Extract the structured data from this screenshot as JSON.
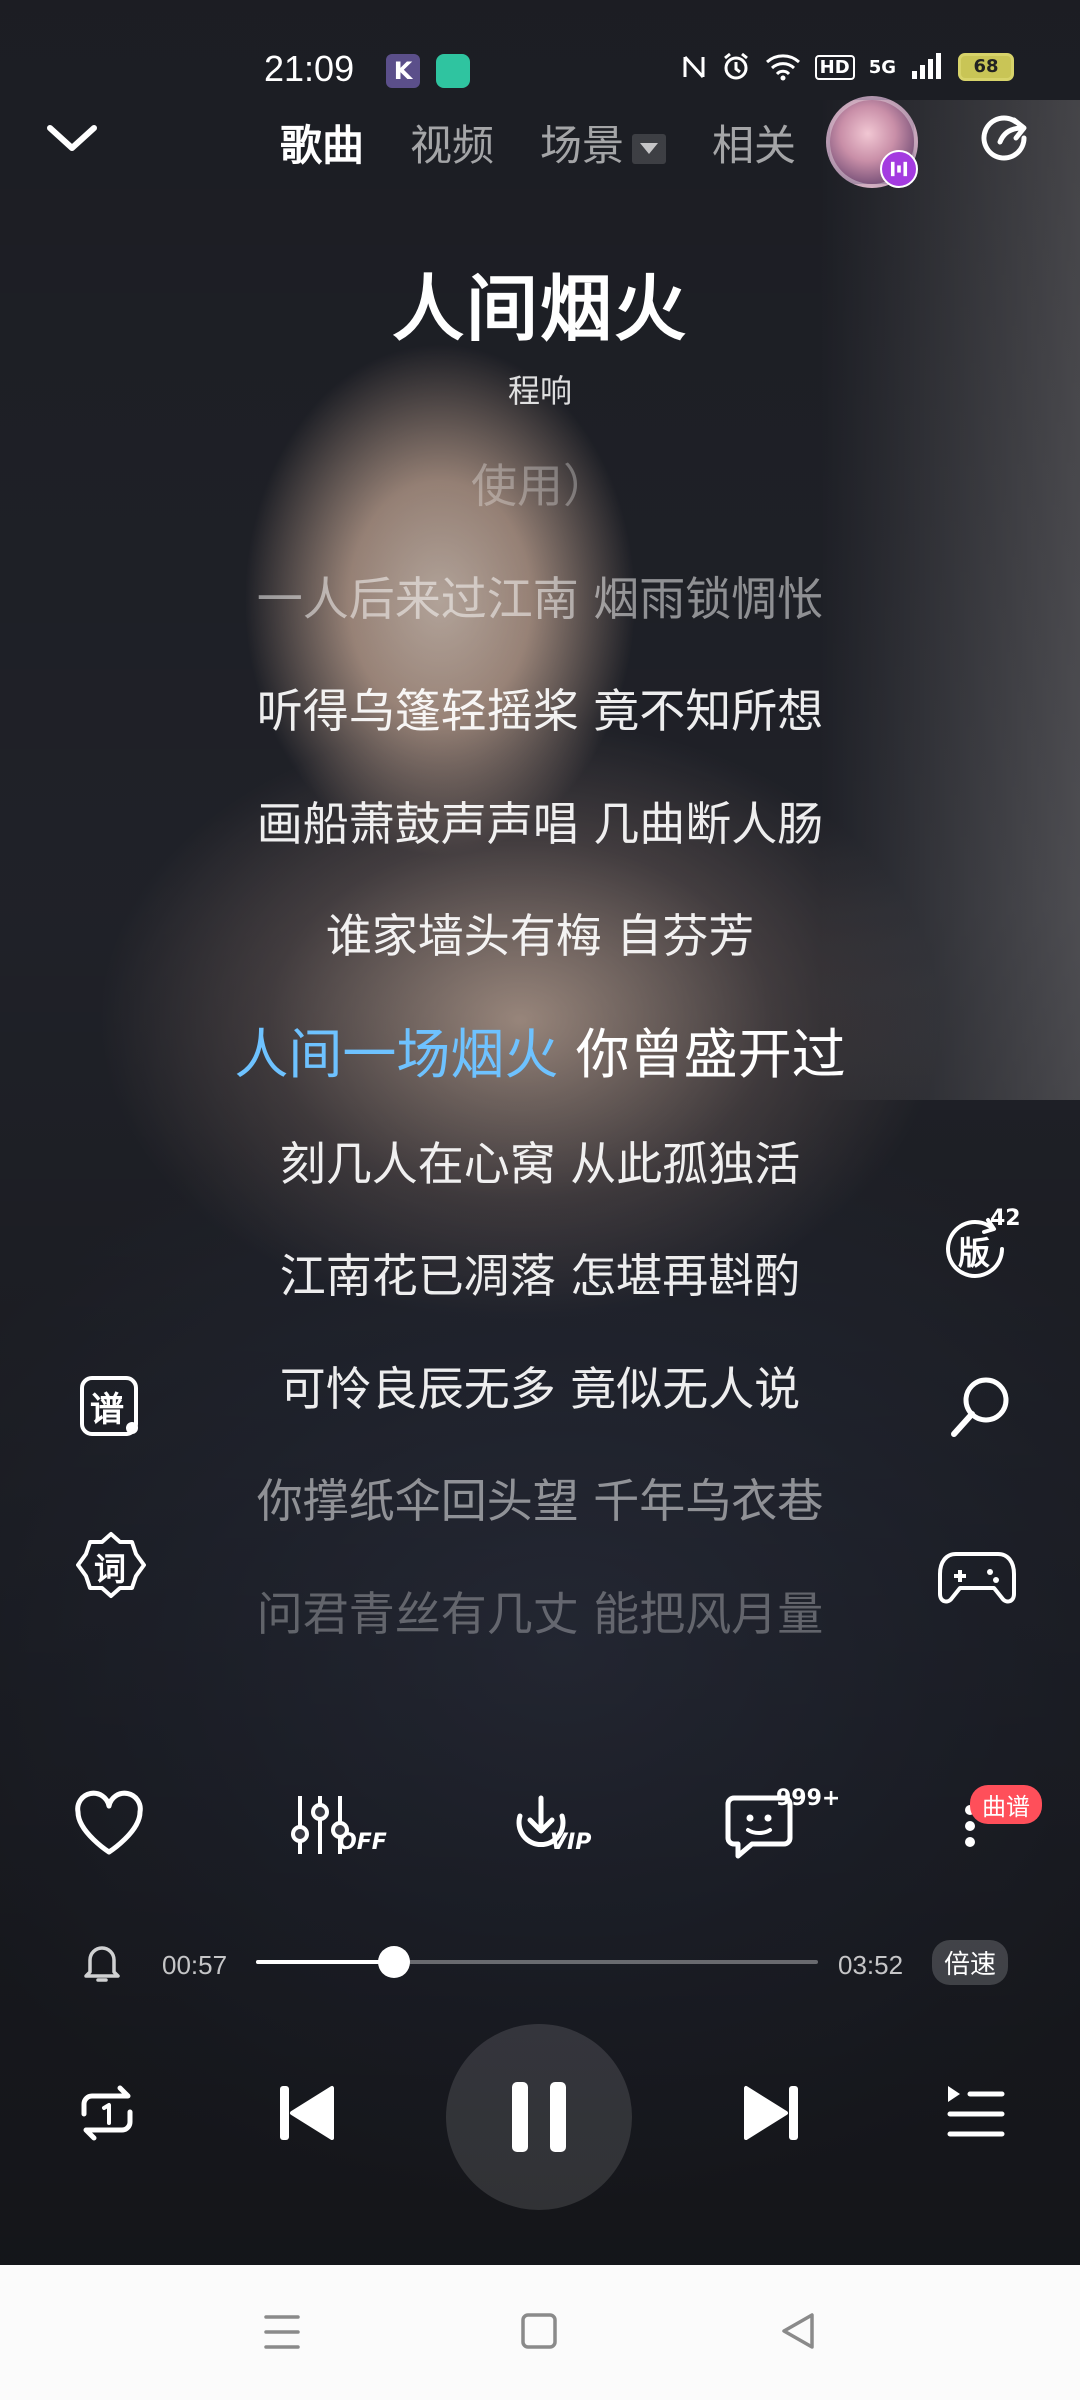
{
  "status_bar": {
    "time": "21:09",
    "app_icon_k": "K",
    "network": "5G",
    "hd": "HD",
    "battery": "68"
  },
  "header": {
    "tabs": [
      {
        "label": "歌曲",
        "active": true
      },
      {
        "label": "视频",
        "active": false
      },
      {
        "label": "场景",
        "active": false
      },
      {
        "label": "相关",
        "active": false
      }
    ]
  },
  "song": {
    "title": "人间烟火",
    "artist": "程响"
  },
  "lyrics": {
    "lines": [
      "使用）",
      "一人后来过江南 烟雨锁惆怅",
      "听得乌篷轻摇桨 竟不知所想",
      "画船萧鼓声声唱 几曲断人肠",
      "谁家墙头有梅 自芬芳",
      "刻几人在心窝 从此孤独活",
      "江南花已凋落 怎堪再斟酌",
      "可怜良辰无多 竟似无人说",
      "你撑纸伞回头望 千年乌衣巷",
      "问君青丝有几丈 能把风月量"
    ],
    "current_sung": "人间一场烟火",
    "current_rest": " 你曾盛开过"
  },
  "side_buttons": {
    "score_label": "谱",
    "lyric_label": "词",
    "version_label": "版",
    "version_count": "42"
  },
  "actions": {
    "effect_label": "OFF",
    "download_label": "VIP",
    "comment_count": "999+",
    "more_badge": "曲谱"
  },
  "progress": {
    "current": "00:57",
    "total": "03:52",
    "fraction": 0.246,
    "speed_label": "倍速"
  },
  "colors": {
    "highlight": "#6ec2ff",
    "badge_red": "#ff4f5a"
  }
}
